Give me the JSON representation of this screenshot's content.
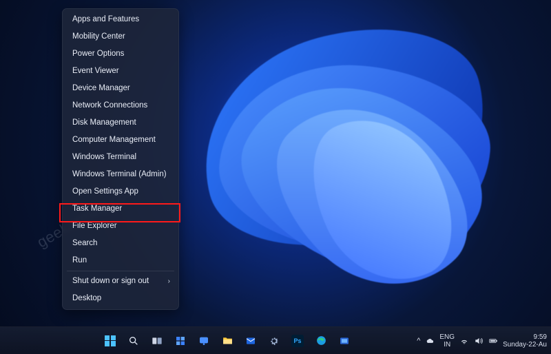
{
  "watermark": "geekermag.com",
  "menu": {
    "items": [
      {
        "label": "Apps and Features",
        "submenu": false
      },
      {
        "label": "Mobility Center",
        "submenu": false
      },
      {
        "label": "Power Options",
        "submenu": false
      },
      {
        "label": "Event Viewer",
        "submenu": false
      },
      {
        "label": "Device Manager",
        "submenu": false
      },
      {
        "label": "Network Connections",
        "submenu": false
      },
      {
        "label": "Disk Management",
        "submenu": false
      },
      {
        "label": "Computer Management",
        "submenu": false
      },
      {
        "label": "Windows Terminal",
        "submenu": false
      },
      {
        "label": "Windows Terminal (Admin)",
        "submenu": false
      },
      {
        "label": "Open Settings App",
        "submenu": false,
        "highlighted": true
      },
      {
        "label": "Task Manager",
        "submenu": false
      },
      {
        "label": "File Explorer",
        "submenu": false
      },
      {
        "label": "Search",
        "submenu": false
      },
      {
        "label": "Run",
        "submenu": false
      },
      {
        "label": "Shut down or sign out",
        "submenu": true
      },
      {
        "label": "Desktop",
        "submenu": false
      }
    ],
    "separators_after_index": [
      14
    ]
  },
  "taskbar": {
    "center_icons": [
      {
        "name": "start-icon"
      },
      {
        "name": "search-icon"
      },
      {
        "name": "task-view-icon"
      },
      {
        "name": "widgets-icon"
      },
      {
        "name": "chat-icon"
      },
      {
        "name": "file-explorer-icon"
      },
      {
        "name": "mail-icon"
      },
      {
        "name": "settings-icon"
      },
      {
        "name": "photoshop-icon"
      },
      {
        "name": "edge-icon"
      },
      {
        "name": "snip-icon"
      }
    ],
    "right": {
      "chevron": "^",
      "onedrive": "cloud-icon",
      "lang_top": "ENG",
      "lang_bottom": "IN",
      "wifi": "wifi-icon",
      "volume": "volume-icon",
      "battery": "battery-icon",
      "time": "9:59",
      "date": "Sunday-22-Au"
    }
  }
}
